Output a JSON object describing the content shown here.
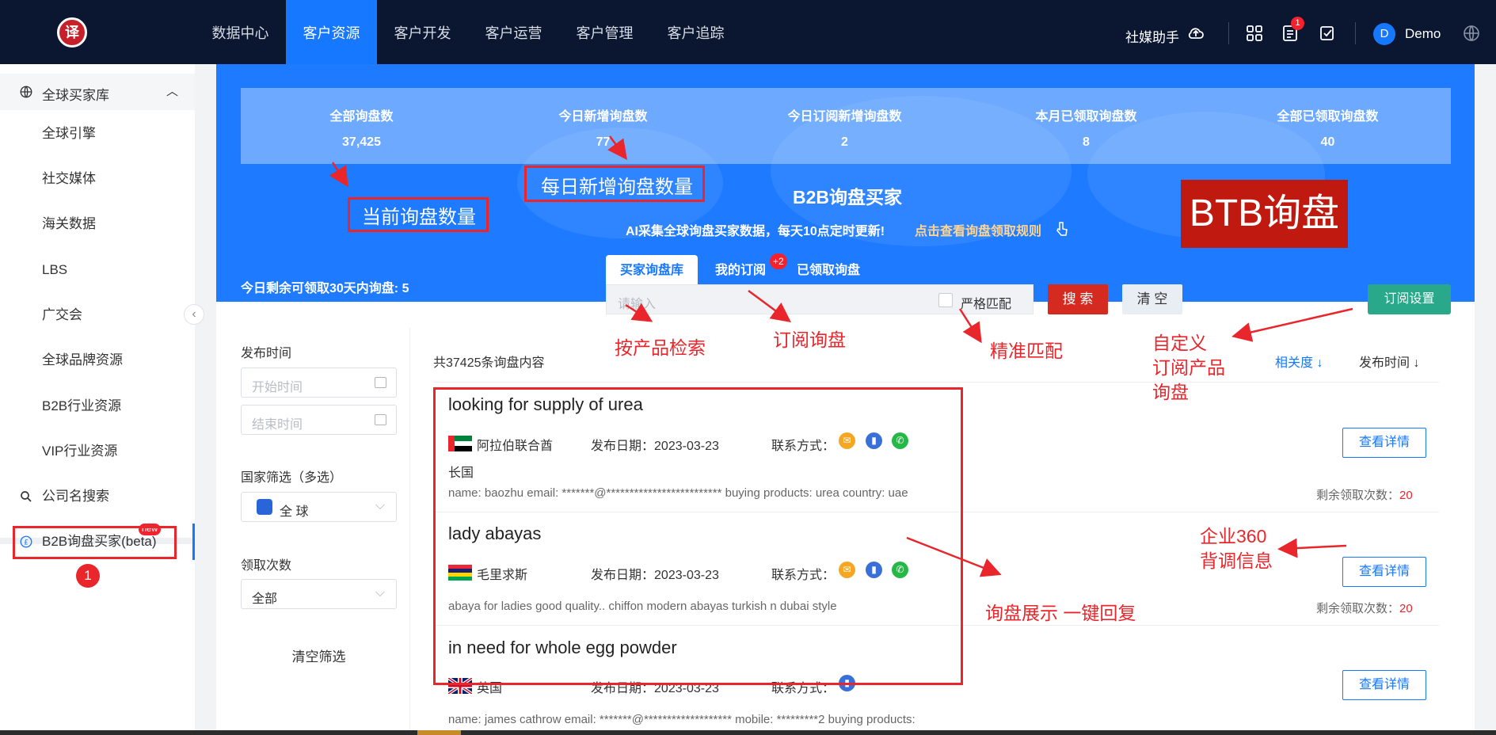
{
  "topbar": {
    "logo": "译",
    "nav": [
      "数据中心",
      "客户资源",
      "客户开发",
      "客户运营",
      "客户管理",
      "客户追踪"
    ],
    "active_nav": "客户资源",
    "social_helper": "社媒助手",
    "notification_count": "1",
    "user_initial": "D",
    "user_name": "Demo"
  },
  "sidebar": {
    "group": "全球买家库",
    "items": [
      "全球引擎",
      "社交媒体",
      "海关数据",
      "LBS",
      "广交会",
      "全球品牌资源",
      "B2B行业资源",
      "VIP行业资源"
    ],
    "company_search": "公司名搜索",
    "b2b_item": "B2B询盘买家(beta)",
    "new_badge": "new"
  },
  "stats": [
    {
      "title": "全部询盘数",
      "value": "37,425"
    },
    {
      "title": "今日新增询盘数",
      "value": "77"
    },
    {
      "title": "今日订阅新增询盘数",
      "value": "2"
    },
    {
      "title": "本月已领取询盘数",
      "value": "8"
    },
    {
      "title": "全部已领取询盘数",
      "value": "40"
    }
  ],
  "banner": {
    "title": "B2B询盘买家",
    "subtitle": "AI采集全球询盘买家数据，每天10点定时更新!",
    "rule_link": "点击查看询盘领取规则",
    "remain_label": "今日剩余可领取30天内询盘:",
    "remain_value": "5"
  },
  "tabs": [
    "买家询盘库",
    "我的订阅",
    "已领取询盘"
  ],
  "subscription_badge": "+2",
  "search": {
    "placeholder": "请输入",
    "strict_match": "严格匹配",
    "search_btn": "搜 索",
    "clear_btn": "清 空",
    "subscribe_settings": "订阅设置"
  },
  "filters": {
    "publish_time": "发布时间",
    "start_placeholder": "开始时间",
    "end_placeholder": "结束时间",
    "country_label": "国家筛选（多选）",
    "country_value": "全 球",
    "claim_label": "领取次数",
    "claim_value": "全部",
    "clear": "清空筛选"
  },
  "list": {
    "total": "共37425条询盘内容",
    "sort_relevance": "相关度",
    "sort_time": "发布时间",
    "date_label": "发布日期：",
    "contact_label": "联系方式：",
    "remain_label": "剩余领取次数：",
    "detail_btn": "查看详情",
    "items": [
      {
        "title": "looking for supply of urea",
        "country": "阿拉伯联合酋长国",
        "country_line1": "阿拉伯联合酋",
        "country_line2": "长国",
        "date": "2023-03-23",
        "desc": "name: baozhu email: *******@************************* buying products: urea country: uae",
        "remain": "20"
      },
      {
        "title": "lady abayas",
        "country": "毛里求斯",
        "date": "2023-03-23",
        "desc": "abaya for ladies good quality.. chiffon modern abayas turkish n dubai style",
        "remain": "20"
      },
      {
        "title": "in need for whole egg powder",
        "country": "英国",
        "date": "2023-03-23",
        "desc": "name: james cathrow email: *******@******************* mobile: *********2 buying products:"
      }
    ]
  },
  "annotations": {
    "current_count": "当前询盘数量",
    "daily_new": "每日新增询盘数量",
    "btb": "BTB询盘",
    "by_product": "按产品检索",
    "subscribe": "订阅询盘",
    "precise": "精准匹配",
    "custom_line1": "自定义",
    "custom_line2": "订阅产品",
    "custom_line3": "询盘",
    "display": "询盘展示 一键回复",
    "ent360_line1": "企业360",
    "ent360_line2": "背调信息",
    "step": "1"
  },
  "colors": {
    "accent": "#1677ff",
    "topbar": "#0b1730",
    "annotation": "#e8262b",
    "banner": "#1e7bff"
  }
}
